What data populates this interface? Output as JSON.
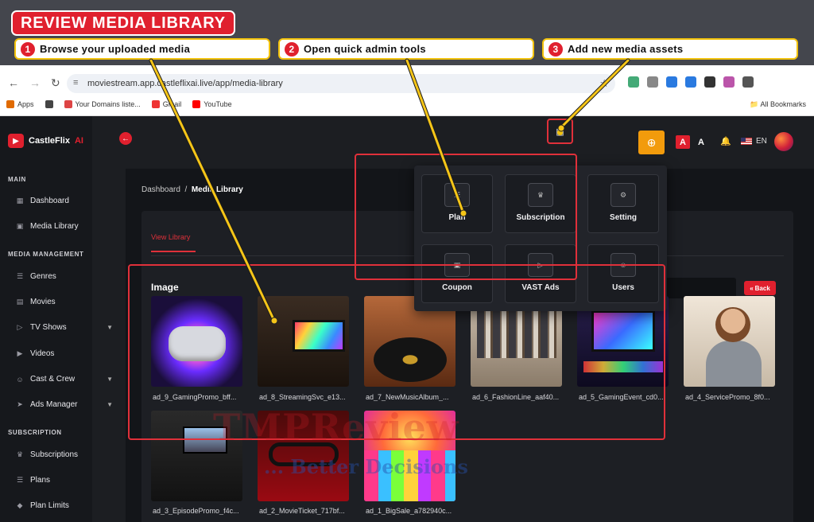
{
  "banner": {
    "title": "REVIEW MEDIA LIBRARY",
    "steps": [
      {
        "num": "1",
        "text": "Browse your uploaded media"
      },
      {
        "num": "2",
        "text": "Open quick admin tools"
      },
      {
        "num": "3",
        "text": "Add new media assets"
      }
    ]
  },
  "browser": {
    "url": "moviestream.app.castleflixai.live/app/media-library",
    "bookmarks": [
      "Apps",
      "Your Domains liste...",
      "Gmail",
      "YouTube"
    ],
    "all_bookmarks": "All Bookmarks",
    "ext_colors": [
      "#4a7",
      "#888",
      "#2a7ae0",
      "#2a7ae0",
      "#333",
      "#b5a",
      "#555"
    ]
  },
  "app": {
    "brand": "CastleFlix",
    "brand_suffix": "AI",
    "sidebar": {
      "sections": {
        "main": "MAIN",
        "media_management": "MEDIA MANAGEMENT",
        "subscription": "SUBSCRIPTION"
      },
      "items": [
        {
          "label": "Dashboard",
          "icon": "grid-icon"
        },
        {
          "label": "Media Library",
          "icon": "image-icon"
        },
        {
          "label": "Genres",
          "icon": "list-icon"
        },
        {
          "label": "Movies",
          "icon": "film-icon"
        },
        {
          "label": "TV Shows",
          "icon": "tv-icon"
        },
        {
          "label": "Videos",
          "icon": "play-icon"
        },
        {
          "label": "Cast & Crew",
          "icon": "users-icon"
        },
        {
          "label": "Ads Manager",
          "icon": "megaphone-icon"
        },
        {
          "label": "Subscriptions",
          "icon": "crown-icon"
        },
        {
          "label": "Plans",
          "icon": "list-icon"
        },
        {
          "label": "Plan Limits",
          "icon": "tag-icon"
        }
      ]
    },
    "header": {
      "lang_code": "EN",
      "letter_a": "A",
      "accent": "#e0202e",
      "add_color": "#f29b0c"
    },
    "breadcrumb": {
      "root": "Dashboard",
      "separator": "/",
      "current": "Media Library"
    },
    "tab": "View Library",
    "back_label": "Back",
    "section_heading": "Image",
    "media": [
      "ad_9_GamingPromo_bff...",
      "ad_8_StreamingSvc_e13...",
      "ad_7_NewMusicAlbum_...",
      "ad_6_FashionLine_aaf40...",
      "ad_5_GamingEvent_cd0...",
      "ad_4_ServicePromo_8f0...",
      "ad_3_EpisodePromo_f4c...",
      "ad_2_MovieTicket_717bf...",
      "ad_1_BigSale_a782940c..."
    ],
    "quick_admin": [
      {
        "label": "Plan",
        "icon": "list-icon"
      },
      {
        "label": "Subscription",
        "icon": "crown-icon"
      },
      {
        "label": "Setting",
        "icon": "gear-icon"
      },
      {
        "label": "Coupon",
        "icon": "ticket-icon"
      },
      {
        "label": "VAST Ads",
        "icon": "play-icon"
      },
      {
        "label": "Users",
        "icon": "users-icon"
      }
    ]
  },
  "watermark": {
    "main": "TMPReview",
    "tagline": "... Better Decisions"
  }
}
